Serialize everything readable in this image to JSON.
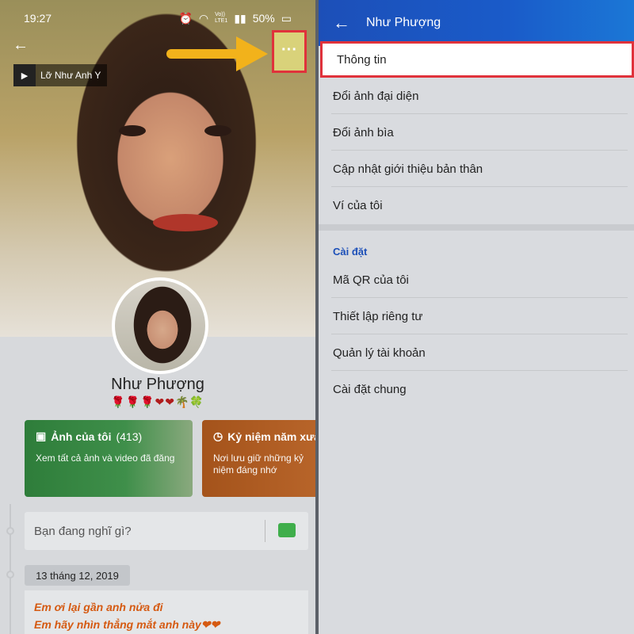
{
  "left": {
    "status": {
      "time": "19:27",
      "icons": [
        "alarm-icon",
        "wifi-icon",
        "signal-icon"
      ],
      "network": "Vo))\nLTE1",
      "battery": "50%"
    },
    "music": {
      "title": "Lỡ Như Anh Y"
    },
    "profile": {
      "name": "Như Phượng",
      "bio_emoji": "🌹🌹🌹❤❤🌴🍀"
    },
    "cards": [
      {
        "title": "Ảnh của tôi",
        "count": "(413)",
        "desc": "Xem tất cả ảnh và video đã đăng"
      },
      {
        "title": "Kỷ niệm năm xưa",
        "desc": "Nơi lưu giữ những kỷ niệm đáng nhớ"
      }
    ],
    "post": {
      "placeholder": "Bạn đang nghĩ gì?"
    },
    "timeline": {
      "date": "13 tháng 12, 2019",
      "text_line1": "Em ơi lại gần anh nửa đi",
      "text_line2": "Em hãy nhìn thẳng mắt anh này❤❤"
    }
  },
  "right": {
    "header": {
      "title": "Như Phượng"
    },
    "menu": [
      "Thông tin",
      "Đổi ảnh đại diện",
      "Đổi ảnh bìa",
      "Cập nhật giới thiệu bản thân",
      "Ví của tôi"
    ],
    "settings_title": "Cài đặt",
    "settings": [
      "Mã QR của tôi",
      "Thiết lập riêng tư",
      "Quản lý tài khoản",
      "Cài đặt chung"
    ]
  },
  "colors": {
    "accent": "#1c4fb8",
    "highlight": "#e0323b",
    "arrow": "#f2b21b"
  }
}
